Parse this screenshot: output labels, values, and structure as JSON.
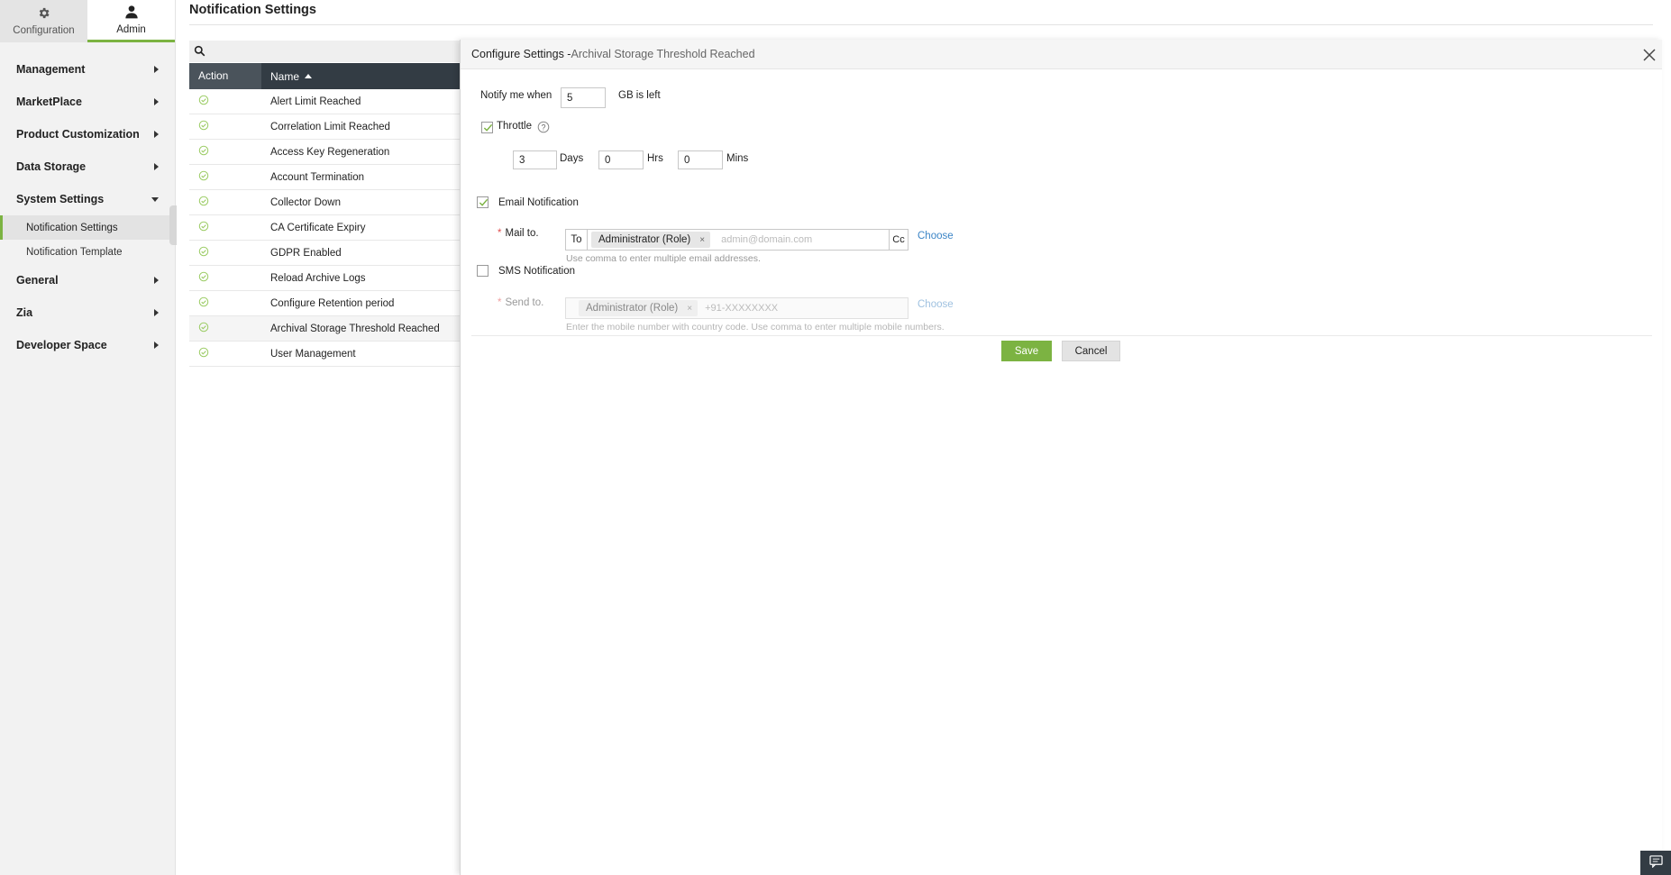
{
  "colors": {
    "accent": "#7cb342",
    "link": "#3c85c6",
    "header_dark": "#333c44",
    "required": "#e05050"
  },
  "top_tabs": [
    {
      "label": "Configuration",
      "icon": "gear-icon",
      "active": false
    },
    {
      "label": "Admin",
      "icon": "user-icon",
      "active": true
    }
  ],
  "sidebar": {
    "items": [
      {
        "label": "Management"
      },
      {
        "label": "MarketPlace"
      },
      {
        "label": "Product Customization"
      },
      {
        "label": "Data Storage"
      },
      {
        "label": "System Settings",
        "expanded": true,
        "children": [
          {
            "label": "Notification Settings",
            "selected": true
          },
          {
            "label": "Notification Template"
          }
        ]
      },
      {
        "label": "General"
      },
      {
        "label": "Zia"
      },
      {
        "label": "Developer Space"
      }
    ]
  },
  "page": {
    "title": "Notification Settings"
  },
  "table": {
    "columns": [
      {
        "label": "Action"
      },
      {
        "label": "Name",
        "sort": "asc"
      }
    ],
    "rows": [
      {
        "name": "Alert Limit Reached"
      },
      {
        "name": "Correlation Limit Reached"
      },
      {
        "name": "Access Key Regeneration"
      },
      {
        "name": "Account Termination"
      },
      {
        "name": "Collector Down"
      },
      {
        "name": "CA Certificate Expiry"
      },
      {
        "name": "GDPR Enabled"
      },
      {
        "name": "Reload Archive Logs"
      },
      {
        "name": "Configure Retention period"
      },
      {
        "name": "Archival Storage Threshold Reached",
        "highlighted": true
      },
      {
        "name": "User Management"
      }
    ]
  },
  "panel": {
    "title": "Configure Settings - ",
    "subtitle": "Archival Storage Threshold Reached",
    "notify": {
      "label": "Notify me when",
      "value": "5",
      "suffix": "GB is left"
    },
    "throttle": {
      "label": "Throttle",
      "checked": true,
      "days": "3",
      "days_label": "Days",
      "hrs": "0",
      "hrs_label": "Hrs",
      "mins": "0",
      "mins_label": "Mins"
    },
    "email": {
      "label": "Email Notification",
      "checked": true,
      "mail_to_label": "Mail to.",
      "to_label": "To",
      "chip": "Administrator (Role)",
      "chip_close": "×",
      "placeholder": "admin@domain.com",
      "cc_label": "Cc",
      "choose_label": "Choose",
      "hint": "Use comma to enter multiple email addresses."
    },
    "sms": {
      "label": "SMS Notification",
      "checked": false,
      "send_to_label": "Send to.",
      "chip": "Administrator (Role)",
      "chip_close": "×",
      "placeholder": "+91-XXXXXXXX",
      "choose_label": "Choose",
      "hint": "Enter the mobile number with country code. Use comma to enter multiple mobile numbers."
    },
    "save_label": "Save",
    "cancel_label": "Cancel"
  },
  "required_mark": "*"
}
